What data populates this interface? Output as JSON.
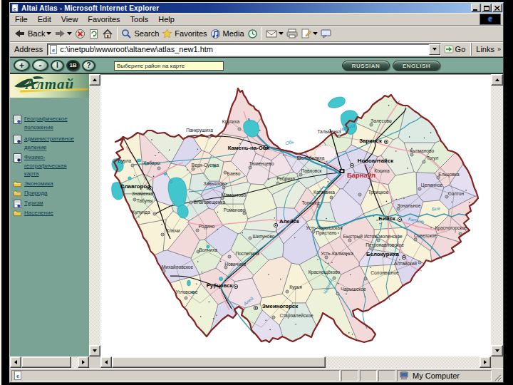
{
  "window": {
    "title": "Altai Atlas - Microsoft Internet Explorer"
  },
  "menu": {
    "items": [
      "File",
      "Edit",
      "View",
      "Favorites",
      "Tools",
      "Help"
    ]
  },
  "toolbar": {
    "back_label": "Back",
    "search_label": "Search",
    "favorites_label": "Favorites",
    "media_label": "Media"
  },
  "address": {
    "label": "Address",
    "value": "c:\\inetpub\\wwwroot\\altanew\\atlas_new1.htm",
    "go_label": "Go",
    "links_label": "Links"
  },
  "appbar": {
    "buttons": [
      {
        "glyph": "+"
      },
      {
        "glyph": "-"
      },
      {
        "glyph": "I"
      },
      {
        "glyph": "1В"
      },
      {
        "glyph": "?"
      }
    ],
    "prompt": "Выберите район на карте",
    "russian_label": "RUSSIAN",
    "english_label": "ENGLISH"
  },
  "sidebar": {
    "logo_text": "Алтай",
    "items": [
      {
        "label": "Географическое положение"
      },
      {
        "label": "административное деление"
      },
      {
        "label": "Физико-географическая карта"
      },
      {
        "label": "Экономика"
      },
      {
        "label": "Природа"
      },
      {
        "label": "Туризм"
      },
      {
        "label": "Население"
      }
    ]
  },
  "map": {
    "towns": [
      {
        "name": "Бурла"
      },
      {
        "name": "Хабары"
      },
      {
        "name": "Панкрушиха"
      },
      {
        "name": "Крутиха"
      },
      {
        "name": "Камень-на-Оби"
      },
      {
        "name": "Верх-Суетка"
      },
      {
        "name": "Славгород"
      },
      {
        "name": "Знаменка"
      },
      {
        "name": "Табуны"
      },
      {
        "name": "Кулунда"
      },
      {
        "name": "Благовещенка"
      },
      {
        "name": "Ключи"
      },
      {
        "name": "Родино"
      },
      {
        "name": "Романово"
      },
      {
        "name": "Мамонтово"
      },
      {
        "name": "Завьялово"
      },
      {
        "name": "Баево"
      },
      {
        "name": "Тюменцево"
      },
      {
        "name": "Шелаболиха"
      },
      {
        "name": "Ребриха"
      },
      {
        "name": "Павловск"
      },
      {
        "name": "Тальменка"
      },
      {
        "name": "Залесово"
      },
      {
        "name": "Заринск"
      },
      {
        "name": "Кытманово"
      },
      {
        "name": "Тогул"
      },
      {
        "name": "Ельцовка"
      },
      {
        "name": "Целинное"
      },
      {
        "name": "Солтон"
      },
      {
        "name": "Новоалтайск"
      },
      {
        "name": "Барнаул"
      },
      {
        "name": "Косиха"
      },
      {
        "name": "Троицкое"
      },
      {
        "name": "Зональное"
      },
      {
        "name": "Бийск"
      },
      {
        "name": "Красногорское"
      },
      {
        "name": "Советское"
      },
      {
        "name": "Смоленское"
      },
      {
        "name": "Петропавловское"
      },
      {
        "name": "Быстрый Исток"
      },
      {
        "name": "Усть-Чарышская"
      },
      {
        "name": "Пристань"
      },
      {
        "name": "Усть-Калманка"
      },
      {
        "name": "Белокуриха"
      },
      {
        "name": "Алтайский"
      },
      {
        "name": "Солонешное"
      },
      {
        "name": "Чарышское"
      },
      {
        "name": "Краснощёково"
      },
      {
        "name": "Курья"
      },
      {
        "name": "Змеиногорск"
      },
      {
        "name": "Староалейское"
      },
      {
        "name": "Рубцовск"
      },
      {
        "name": "Угловское"
      },
      {
        "name": "Михайловское"
      },
      {
        "name": "Волчиха"
      },
      {
        "name": "Новичиха"
      },
      {
        "name": "Поспелиха"
      },
      {
        "name": "Шипуново"
      },
      {
        "name": "Алейск"
      },
      {
        "name": "Калманка"
      },
      {
        "name": "Топчиха"
      }
    ],
    "rivers": [
      {
        "name": "Обь"
      },
      {
        "name": "Чумыш"
      },
      {
        "name": "Катунь"
      },
      {
        "name": "Бия"
      },
      {
        "name": "Алей"
      },
      {
        "name": "Чарыш"
      }
    ]
  },
  "statusbar": {
    "right_label": "My Computer"
  },
  "colors": {
    "page_green": "#7ba497",
    "title_grad_from": "#0a246a",
    "title_grad_to": "#a6caf0",
    "krai_border": "#832222",
    "water": "#2f95b0"
  }
}
